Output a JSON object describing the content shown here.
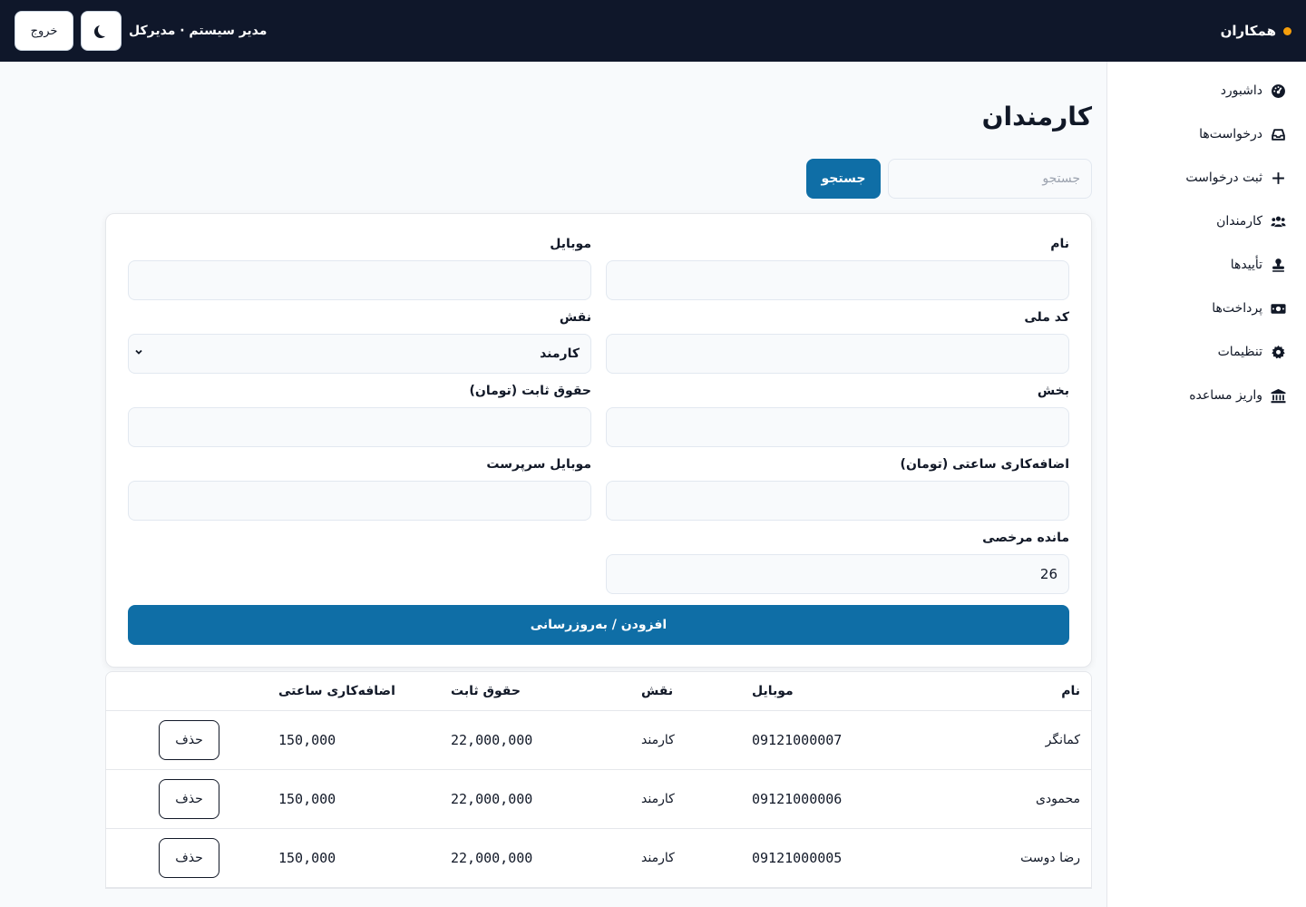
{
  "header": {
    "brand": "همکاران",
    "user": "مدیر سیستم · مدیرکل",
    "logout_label": "خروج"
  },
  "sidebar": {
    "items": [
      {
        "label": "داشبورد",
        "icon": "gauge-icon"
      },
      {
        "label": "درخواست‌ها",
        "icon": "inbox-icon"
      },
      {
        "label": "ثبت درخواست",
        "icon": "plus-icon"
      },
      {
        "label": "کارمندان",
        "icon": "users-icon"
      },
      {
        "label": "تأییدها",
        "icon": "stamp-icon"
      },
      {
        "label": "پرداخت‌ها",
        "icon": "money-icon"
      },
      {
        "label": "تنظیمات",
        "icon": "gear-icon"
      },
      {
        "label": "واریز مساعده",
        "icon": "bank-icon"
      }
    ]
  },
  "page": {
    "title": "کارمندان",
    "search_placeholder": "جستجو",
    "search_button": "جستجو"
  },
  "form": {
    "name_label": "نام",
    "mobile_label": "موبایل",
    "national_id_label": "کد ملی",
    "role_label": "نقش",
    "role_value": "کارمند",
    "department_label": "بخش",
    "salary_label": "حقوق ثابت (تومان)",
    "overtime_label": "اضافه‌کاری ساعتی (تومان)",
    "supervisor_mobile_label": "موبایل سرپرست",
    "leave_label": "مانده مرخصی",
    "leave_value": "26",
    "submit_label": "افزودن / به‌روزرسانی"
  },
  "table": {
    "headers": {
      "name": "نام",
      "mobile": "موبایل",
      "role": "نقش",
      "salary": "حقوق ثابت",
      "overtime": "اضافه‌کاری ساعتی"
    },
    "delete_label": "حذف",
    "rows": [
      {
        "name": "کمانگر",
        "mobile": "09121000007",
        "role": "کارمند",
        "salary": "22,000,000",
        "overtime": "150,000"
      },
      {
        "name": "محمودی",
        "mobile": "09121000006",
        "role": "کارمند",
        "salary": "22,000,000",
        "overtime": "150,000"
      },
      {
        "name": "رضا دوست",
        "mobile": "09121000005",
        "role": "کارمند",
        "salary": "22,000,000",
        "overtime": "150,000"
      }
    ]
  },
  "colors": {
    "topbar": "#0f172a",
    "accent": "#0f6ea6",
    "brand_dot": "#f59e0b"
  }
}
